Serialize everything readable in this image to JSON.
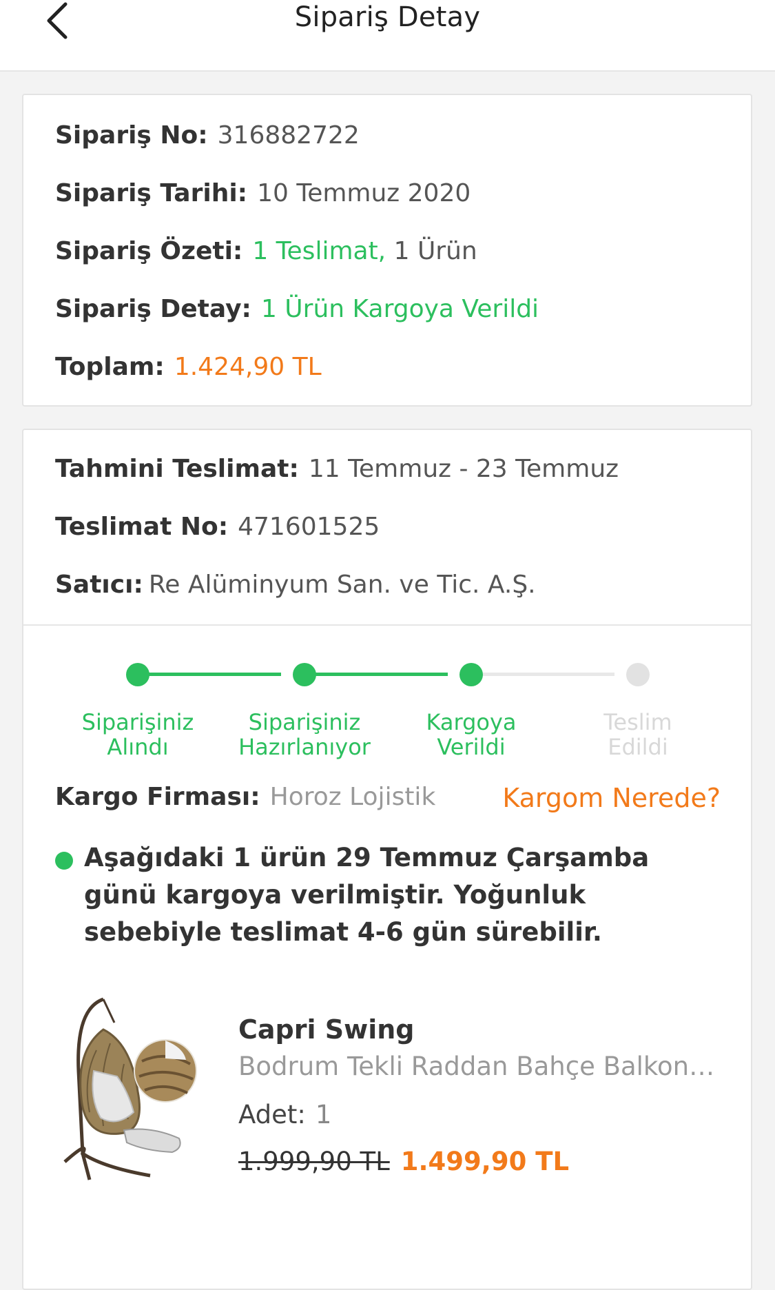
{
  "header": {
    "title": "Sipariş Detay",
    "back_icon": "chevron-left-icon"
  },
  "order": {
    "no_label": "Sipariş No:",
    "no": "316882722",
    "date_label": "Sipariş Tarihi:",
    "date": "10 Temmuz 2020",
    "summary_label": "Sipariş Özeti:",
    "summary_deliveries": "1 Teslimat,",
    "summary_items": "1 Ürün",
    "detail_label": "Sipariş Detay:",
    "detail": "1 Ürün Kargoya Verildi",
    "total_label": "Toplam:",
    "total": "1.424,90 TL"
  },
  "delivery": {
    "eta_label": "Tahmini Teslimat:",
    "eta": "11 Temmuz - 23 Temmuz",
    "no_label": "Teslimat No:",
    "no": "471601525",
    "seller_label": "Satıcı:",
    "seller": "Re Alüminyum San. ve Tic. A.Ş."
  },
  "tracking": {
    "steps": [
      {
        "label": "Siparişiniz\nAlındı",
        "done": true
      },
      {
        "label": "Siparişiniz\nHazırlanıyor",
        "done": true
      },
      {
        "label": "Kargoya\nVerildi",
        "done": true
      },
      {
        "label": "Teslim\nEdildi",
        "done": false
      }
    ],
    "carrier_label": "Kargo Firması:",
    "carrier": "Horoz Lojistik",
    "where_link": "Kargom Nerede?",
    "note": "Aşağıdaki 1 ürün 29 Temmuz Çarşamba günü kargoya verilmiştir. Yoğunluk sebebiyle teslimat 4-6 gün sürebilir."
  },
  "product": {
    "brand": "Capri Swing",
    "name": "Bodrum Tekli Raddan Bahçe Balkon S...",
    "qty_label": "Adet:",
    "qty": "1",
    "old_price": "1.999,90 TL",
    "price": "1.499,90 TL",
    "image_icon": "hanging-egg-chair-image"
  },
  "colors": {
    "green": "#2cbf5e",
    "orange": "#f27a1a",
    "muted": "#d8d8d8"
  }
}
